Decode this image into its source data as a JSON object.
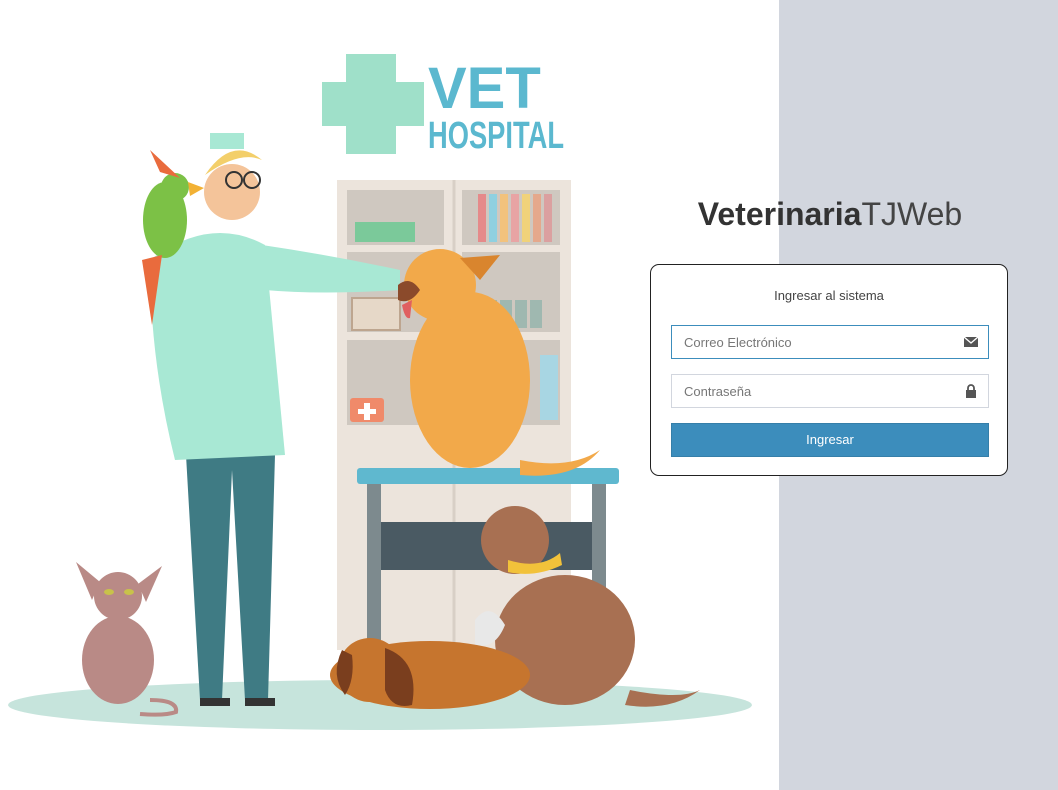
{
  "brand": {
    "bold": "Veterinaria",
    "light": "TJWeb"
  },
  "logo": {
    "line1": "VET",
    "line2": "HOSPITAL"
  },
  "login": {
    "title": "Ingresar al sistema",
    "email_placeholder": "Correo Electrónico",
    "password_placeholder": "Contraseña",
    "submit_label": "Ingresar"
  },
  "colors": {
    "accent": "#3c8dbc",
    "right_panel": "#d2d6de",
    "logo_cross": "#9fe0c9",
    "logo_text": "#5bb8cf"
  },
  "icons": {
    "email": "envelope-icon",
    "password": "lock-icon"
  }
}
